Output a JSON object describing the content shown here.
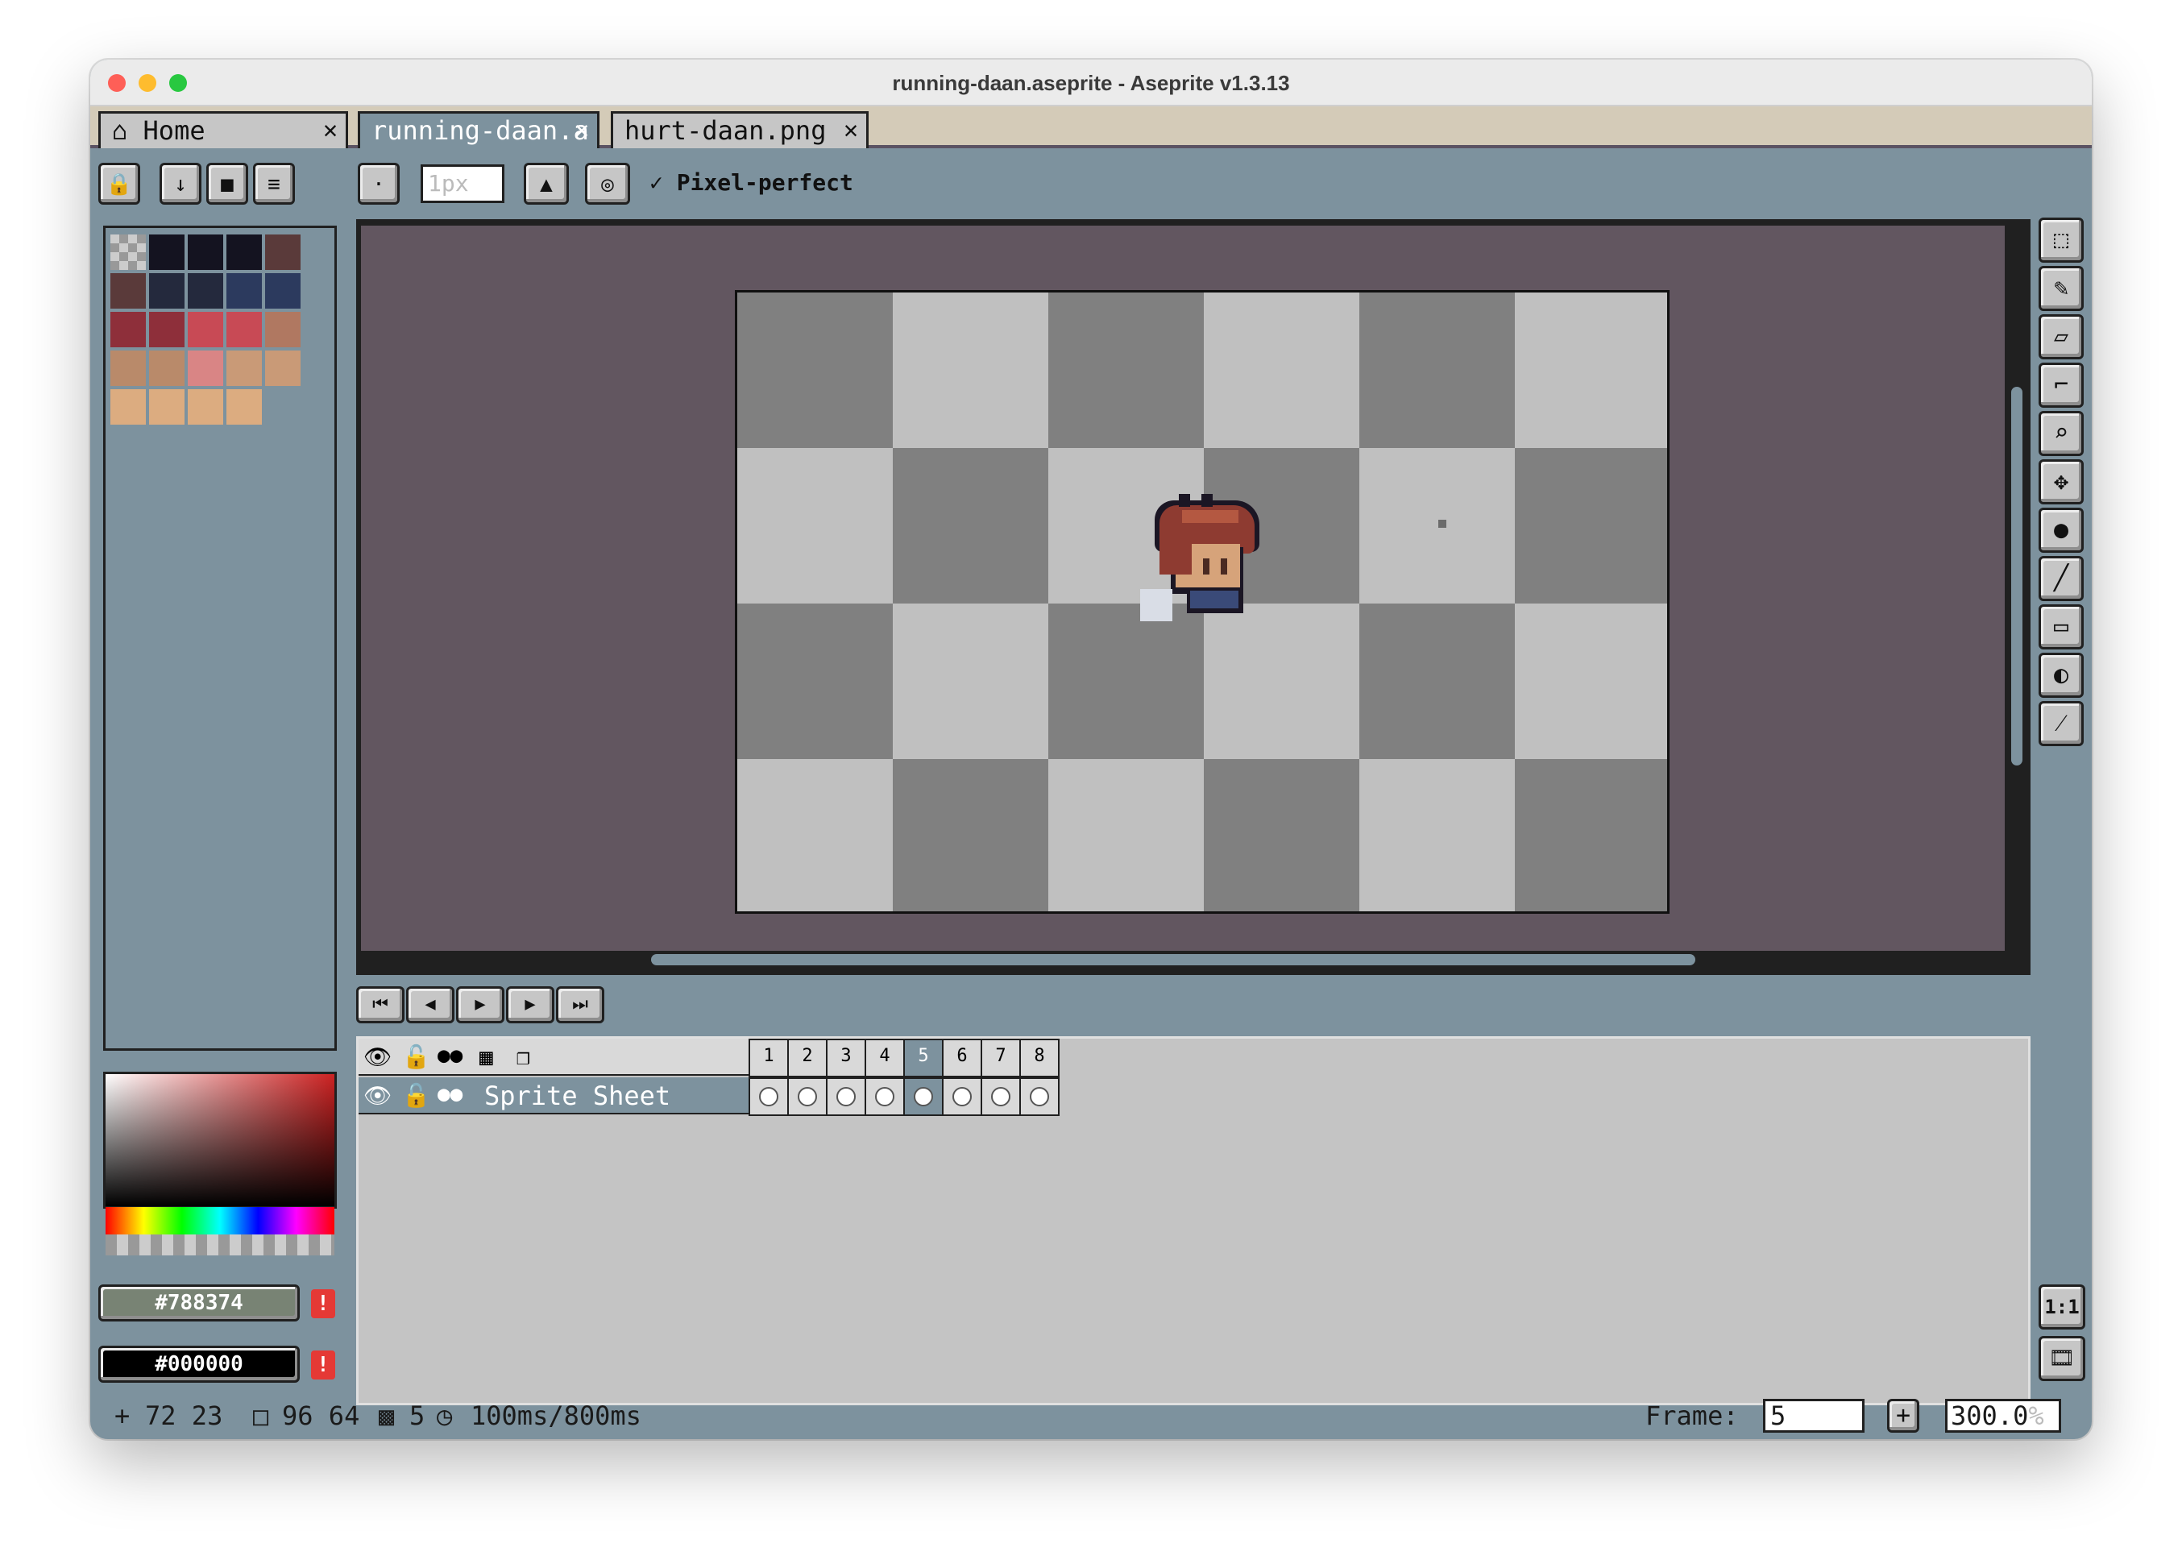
{
  "window": {
    "title": "running-daan.aseprite - Aseprite v1.3.13"
  },
  "tabs": [
    {
      "label": "Home"
    },
    {
      "label": "running-daan.a"
    },
    {
      "label": "hurt-daan.png"
    }
  ],
  "tab_close_glyph": "✕",
  "palette_toolbar": {
    "lock": "🔒",
    "sort": "↓",
    "presets": "■",
    "options": "≡"
  },
  "context_bar": {
    "brush_size": "1px",
    "pixel_perfect_label": "Pixel-perfect",
    "pixel_perfect_checked": true
  },
  "colors": {
    "foreground_hex": "#788374",
    "background_hex": "#000000",
    "canvas_bg": "#625660",
    "checker_light": "#c0c0c0",
    "checker_dark": "#808080"
  },
  "palette": [
    "transparent",
    "#141320",
    "#141320",
    "#141320",
    "#5a3a3a",
    "#5a3a3a",
    "#24293d",
    "#24293d",
    "#2c3a5e",
    "#2c3a5e",
    "#8e2f3a",
    "#8e2f3a",
    "#c84a55",
    "#c84a55",
    "#b07861",
    "#b98a6a",
    "#b98a6a",
    "#d98585",
    "#c99a77",
    "#c99a77",
    "#dcac80",
    "#dcac80",
    "#dcac80",
    "#dcac80"
  ],
  "tools": [
    "rectangular-marquee",
    "pencil",
    "eraser",
    "eyedropper",
    "zoom",
    "move",
    "paint-bucket",
    "line",
    "rectangle",
    "contour",
    "blur"
  ],
  "playback": [
    "first-frame",
    "previous-frame",
    "play",
    "next-frame",
    "last-frame"
  ],
  "timeline": {
    "layer_name": "Sprite Sheet",
    "frames": [
      "1",
      "2",
      "3",
      "4",
      "5",
      "6",
      "7",
      "8"
    ],
    "current_frame_index": 4
  },
  "sidebar_bottom": {
    "one_to_one": "1:1"
  },
  "status": {
    "cursor": "72  23",
    "selection": "96  64",
    "frame_icon_value": "5",
    "duration": "100ms/800ms",
    "frame_label": "Frame:",
    "frame_value": "5",
    "add_frame": "+",
    "zoom": "300.0",
    "zoom_unit": "%"
  }
}
